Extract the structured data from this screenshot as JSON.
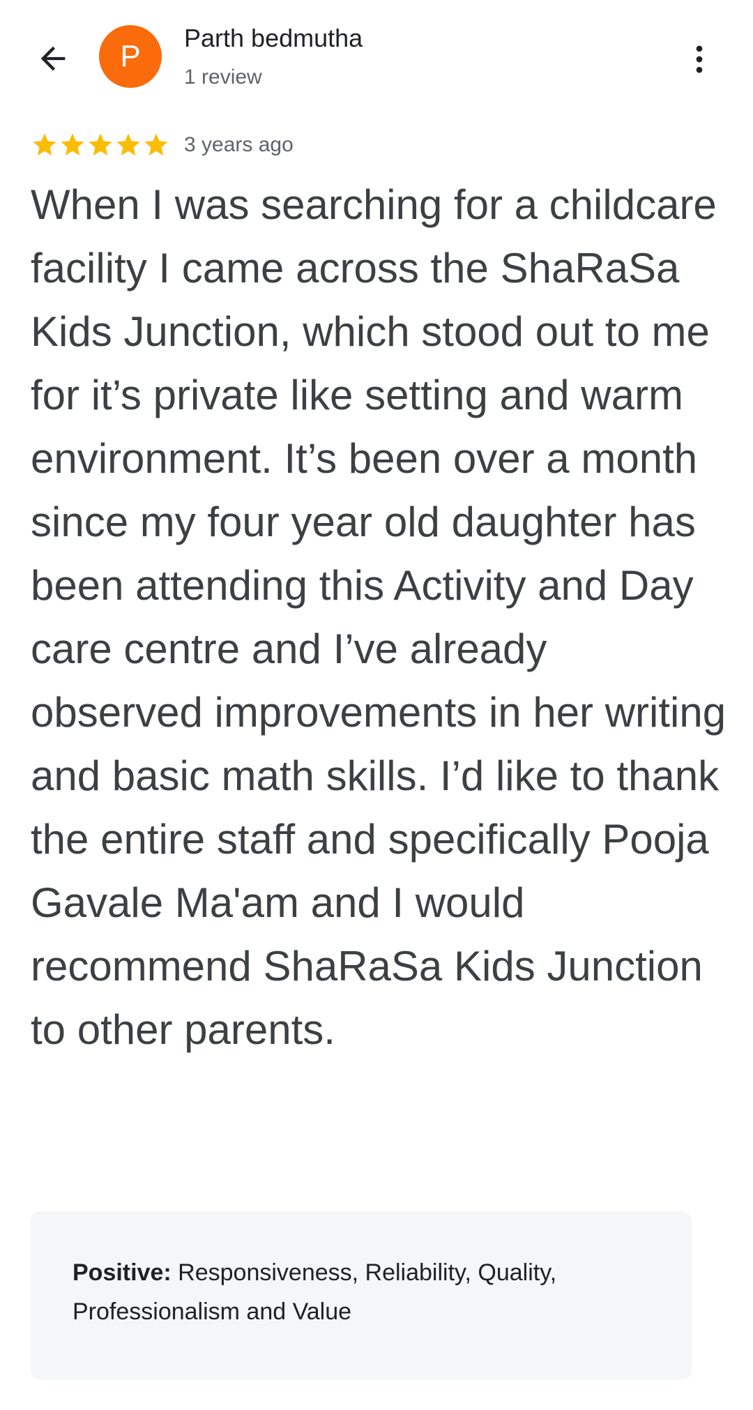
{
  "header": {
    "back_icon": "arrow-left-icon",
    "avatar_letter": "P",
    "avatar_color": "#fa6b0c",
    "reviewer_name": "Parth bedmutha",
    "review_count": "1 review",
    "menu_icon": "more-vert-icon"
  },
  "review": {
    "rating": 5,
    "rating_max": 5,
    "star_color": "#fbbc04",
    "date": "3 years ago",
    "text": "When I was searching for a childcare facility I came across the ShaRaSa Kids Junction, which stood out to me for it’s private like setting and warm environment. It’s been over a month since my four year old daughter has been attending this Activity and Day care centre and I’ve already observed improvements in her writing and basic math skills. I’d like to thank the entire staff and specifically Pooja Gavale Ma'am and I would recommend ShaRaSa Kids Junction to other parents."
  },
  "attributes": {
    "label": "Positive:",
    "value": " Responsiveness, Reliability, Quality, Professionalism and Value"
  }
}
